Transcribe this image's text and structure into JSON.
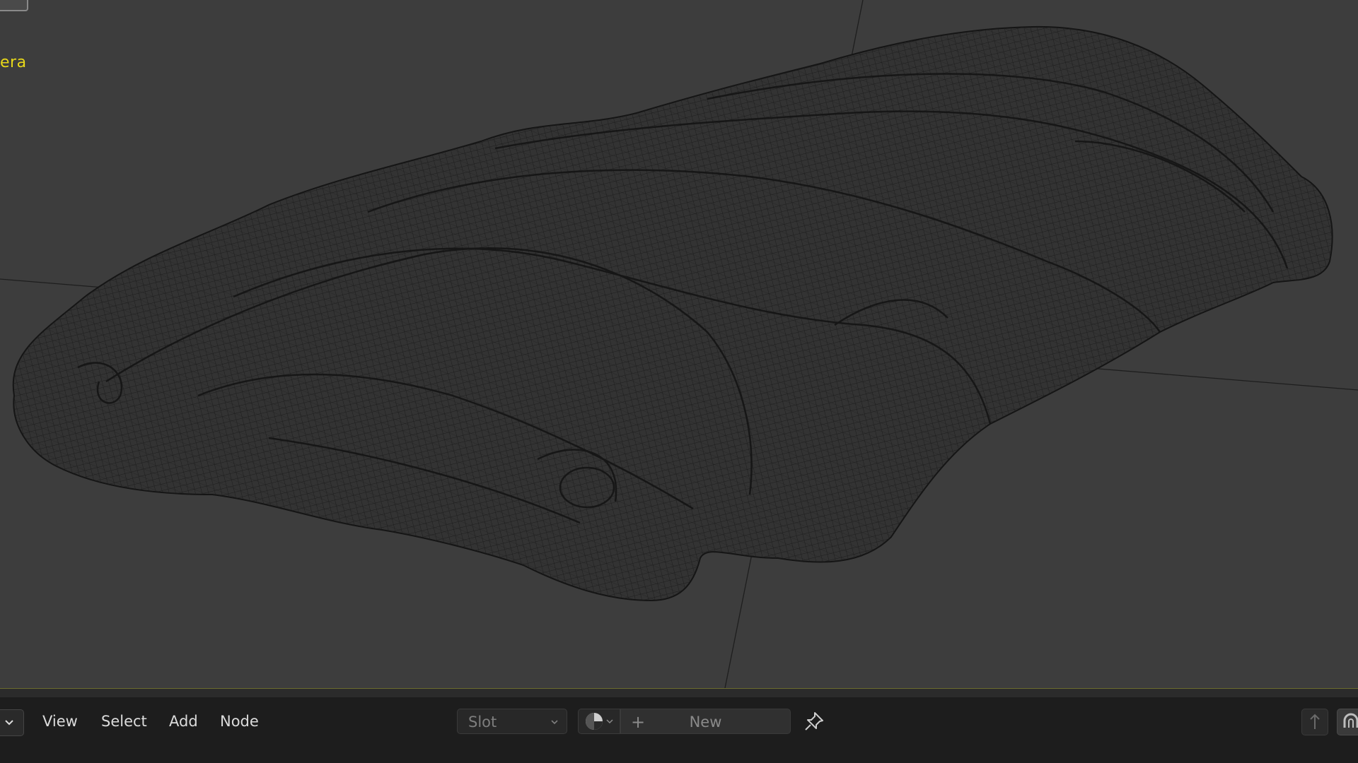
{
  "viewport": {
    "overlay_text": "era",
    "background_color": "#3d3d3d",
    "wire_color": "#1a1a1a",
    "axis_color": "#1e1e1e"
  },
  "header": {
    "menu": {
      "view": "View",
      "select": "Select",
      "add": "Add",
      "node": "Node"
    },
    "slot_dropdown": "Slot",
    "new_button": "New",
    "icons": {
      "editor_type": "chevron-down-icon",
      "material_browse": "material-sphere-icon",
      "add": "plus-icon",
      "pin": "pin-icon",
      "parent": "arrow-up-icon",
      "snap": "snap-icon"
    }
  },
  "colors": {
    "header_bg": "#1d1d1d",
    "text": "#dcdcdc",
    "overlay_yellow": "#e8d81a"
  }
}
